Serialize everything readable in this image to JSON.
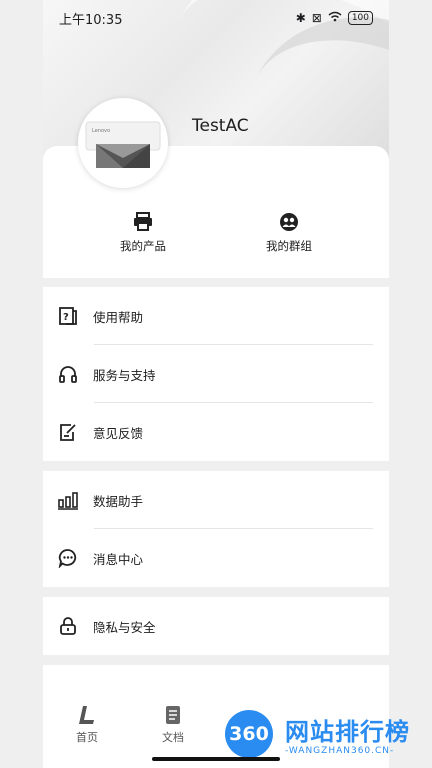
{
  "status_bar": {
    "time": "上午10:35",
    "battery": "100"
  },
  "profile": {
    "username": "TestAC",
    "device_brand": "Lenovo"
  },
  "shortcuts": [
    {
      "label": "我的产品",
      "icon": "printer-icon"
    },
    {
      "label": "我的群组",
      "icon": "group-icon"
    }
  ],
  "menu_groups": [
    [
      {
        "label": "使用帮助",
        "icon": "help-book-icon"
      },
      {
        "label": "服务与支持",
        "icon": "headphones-icon"
      },
      {
        "label": "意见反馈",
        "icon": "feedback-edit-icon"
      }
    ],
    [
      {
        "label": "数据助手",
        "icon": "bar-chart-icon"
      },
      {
        "label": "消息中心",
        "icon": "message-bubble-icon"
      }
    ],
    [
      {
        "label": "隐私与安全",
        "icon": "lock-icon"
      }
    ]
  ],
  "tabbar": [
    {
      "label": "首页",
      "icon": "home-l-icon"
    },
    {
      "label": "文档",
      "icon": "document-icon"
    }
  ],
  "watermark": {
    "badge": "360",
    "title": "网站排行榜",
    "subtitle": "-WANGZHAN360.CN-"
  }
}
